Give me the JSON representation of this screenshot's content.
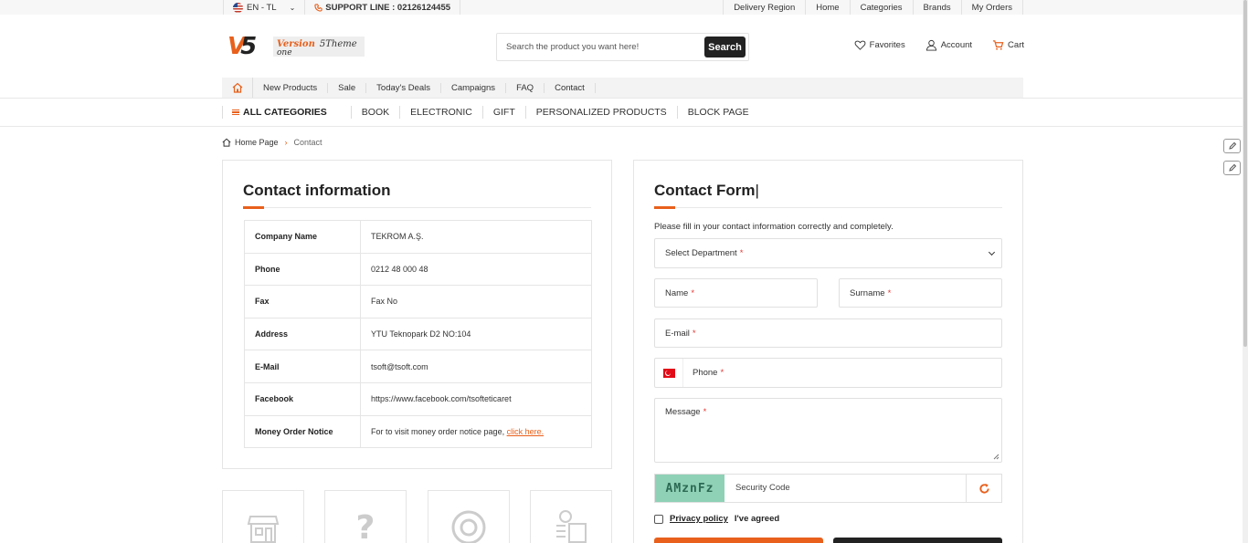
{
  "topbar": {
    "language": "EN - TL",
    "support": "SUPPORT LINE : 02126124455",
    "links": [
      "Delivery Region",
      "Home",
      "Categories",
      "Brands",
      "My Orders"
    ]
  },
  "logo": {
    "line1": "Version",
    "line1b": "5Theme",
    "line2": "one"
  },
  "search": {
    "placeholder": "Search the product you want here!",
    "button": "Search"
  },
  "header_links": {
    "favorites": "Favorites",
    "account": "Account",
    "cart": "Cart"
  },
  "menu": [
    "New Products",
    "Sale",
    "Today's Deals",
    "Campaigns",
    "FAQ",
    "Contact"
  ],
  "categories": {
    "all": "ALL CATEGORIES",
    "items": [
      "BOOK",
      "ELECTRONIC",
      "GIFT",
      "PERSONALIZED PRODUCTS",
      "BLOCK PAGE"
    ]
  },
  "breadcrumb": {
    "home": "Home Page",
    "current": "Contact"
  },
  "contact_info": {
    "title": "Contact information",
    "rows": [
      {
        "key": "Company Name",
        "value": "TEKROM A.Ş."
      },
      {
        "key": "Phone",
        "value": "0212 48 000 48"
      },
      {
        "key": "Fax",
        "value": "Fax No"
      },
      {
        "key": "Address",
        "value": "YTU Teknopark D2 NO:104"
      },
      {
        "key": "E-Mail",
        "value": "tsoft@tsoft.com"
      },
      {
        "key": "Facebook",
        "value": "https://www.facebook.com/tsofteticaret"
      },
      {
        "key": "Money Order Notice",
        "value": "For to visit money order notice page,",
        "link": "click here."
      }
    ]
  },
  "contact_form": {
    "title": "Contact Form",
    "note": "Please fill in your contact information correctly and completely.",
    "department": "Select Department",
    "name": "Name",
    "surname": "Surname",
    "email": "E-mail",
    "phone": "Phone",
    "message": "Message",
    "captcha_code": "AMznFz",
    "security_placeholder": "Security Code",
    "privacy_link": "Privacy policy",
    "privacy_text": "I've agreed",
    "required_mark": "*"
  },
  "colors": {
    "accent": "#e8601c",
    "dark": "#222222",
    "captcha_bg": "#8fd1b7"
  }
}
